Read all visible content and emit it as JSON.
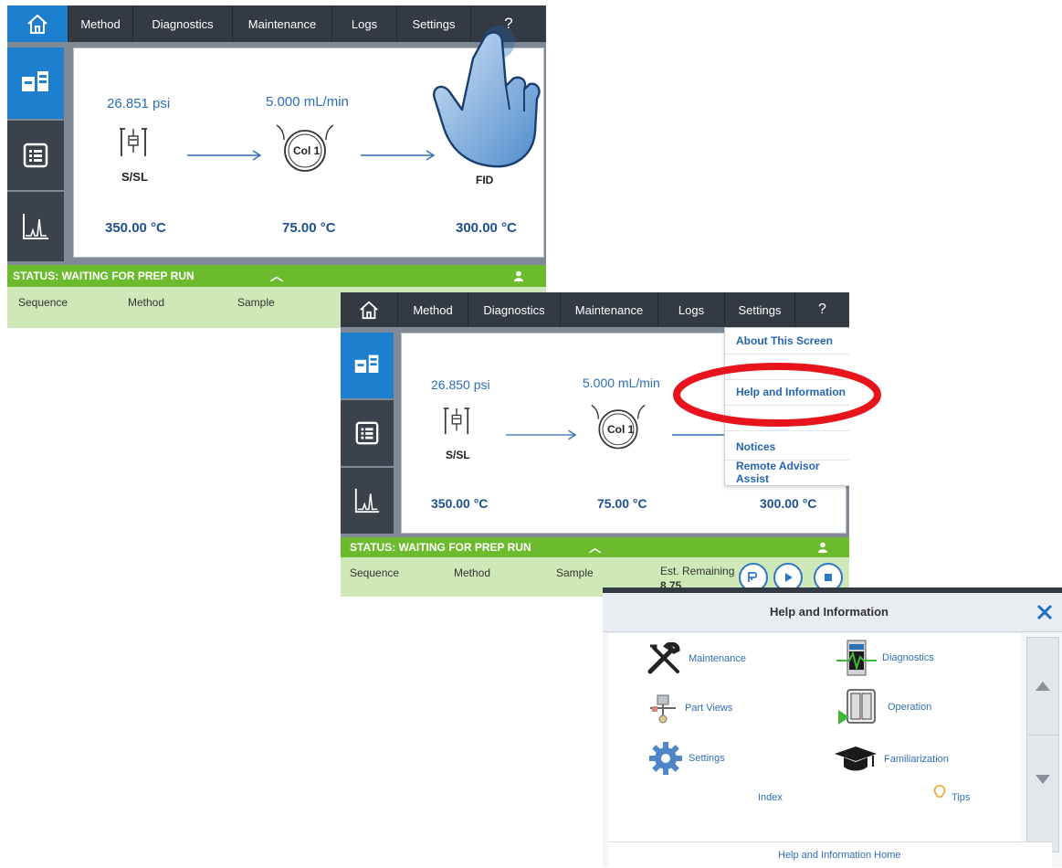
{
  "nav": {
    "tabs": [
      "Method",
      "Diagnostics",
      "Maintenance",
      "Logs",
      "Settings",
      "?"
    ]
  },
  "screen1": {
    "pressure": "26.851 psi",
    "flow": "5.000 mL/min",
    "inlet": "S/SL",
    "column": "Col 1",
    "detector": "FID",
    "inlet_temp": "350.00 °C",
    "oven_temp": "75.00 °C",
    "detector_temp": "300.00 °C",
    "status": "STATUS: WAITING FOR PREP RUN",
    "columns": [
      "Sequence",
      "Method",
      "Sample"
    ]
  },
  "screen2": {
    "pressure": "26.850 psi",
    "flow": "5.000 mL/min",
    "inlet": "S/SL",
    "column": "Col 1",
    "inlet_temp": "350.00 °C",
    "oven_temp": "75.00 °C",
    "detector_temp": "300.00 °C",
    "status": "STATUS: WAITING FOR PREP RUN",
    "columns": [
      "Sequence",
      "Method",
      "Sample"
    ],
    "est_remaining_label": "Est. Remaining",
    "est_remaining_value": "8.75",
    "menu": [
      "About This Screen",
      "Help and Information",
      "Notices",
      "Remote Advisor Assist"
    ]
  },
  "help": {
    "title": "Help and Information",
    "items": [
      "Maintenance",
      "Diagnostics",
      "Part Views",
      "Operation",
      "Settings",
      "Familiarization"
    ],
    "index": "Index",
    "tips": "Tips",
    "footer": "Help and Information Home"
  },
  "colors": {
    "accent": "#1f7fcf",
    "status_green": "#6cbb2f",
    "nav_dark": "#333a43",
    "highlight_red": "#e8141c"
  }
}
